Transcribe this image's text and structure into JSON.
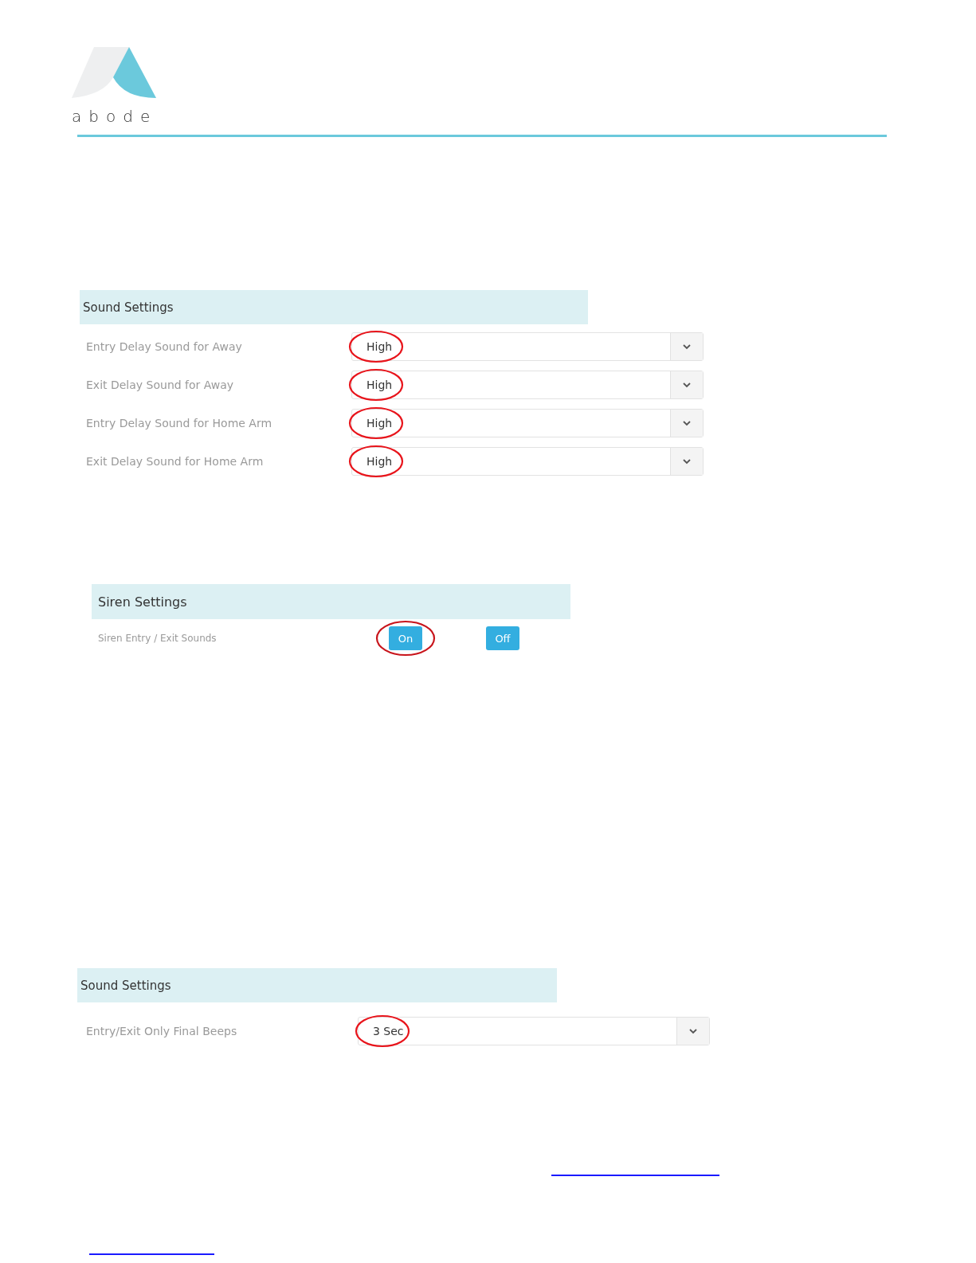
{
  "logo": {
    "wordmark": "abode"
  },
  "sections": [
    {
      "title": "Sound Settings",
      "rows": [
        {
          "kind": "select",
          "label": "Entry Delay Sound for Away",
          "value": "High",
          "highlighted": true
        },
        {
          "kind": "select",
          "label": "Exit Delay Sound for Away",
          "value": "High",
          "highlighted": true
        },
        {
          "kind": "select",
          "label": "Entry Delay Sound for Home Arm",
          "value": "High",
          "highlighted": true
        },
        {
          "kind": "select",
          "label": "Exit Delay Sound for Home Arm",
          "value": "High",
          "highlighted": true
        }
      ]
    },
    {
      "title": "Siren Settings",
      "rows": [
        {
          "kind": "toggle",
          "label": "Siren Entry / Exit Sounds",
          "options": [
            {
              "label": "On",
              "selected": true
            },
            {
              "label": "Off",
              "selected": false
            }
          ]
        }
      ]
    },
    {
      "title": "Sound Settings",
      "rows": [
        {
          "kind": "select",
          "label": "Entry/Exit Only Final Beeps",
          "value": "3 Sec",
          "highlighted": true
        }
      ]
    }
  ]
}
